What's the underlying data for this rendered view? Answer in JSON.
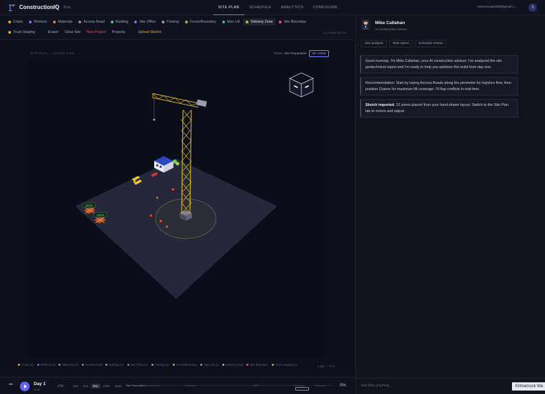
{
  "app": {
    "brand": "ConstructionIQ",
    "badge": "Beta",
    "logo_icon": "crane-logo-icon"
  },
  "nav": {
    "tabs": [
      "SITE PLAN",
      "SCHEDULE",
      "ANALYTICS",
      "CONFIGURE"
    ],
    "active": "SITE PLAN"
  },
  "user": {
    "email": "searchung2008@gmail.c...",
    "avatar_initial": "S"
  },
  "toolbar": {
    "row1": [
      {
        "label": "Crane",
        "color": "#e0a83a"
      },
      {
        "label": "Workers",
        "color": "#4f7fe0"
      },
      {
        "label": "Materials",
        "color": "#e07b3a"
      },
      {
        "label": "Access Road",
        "color": "#8a8f9e"
      },
      {
        "label": "Building",
        "color": "#5fc26b"
      },
      {
        "label": "Site Office",
        "color": "#7d6fe0"
      },
      {
        "label": "Parking",
        "color": "#9a9fae"
      },
      {
        "label": "Fence/Boundary",
        "color": "#c9a13a"
      },
      {
        "label": "Man Lift",
        "color": "#3fb4c9"
      },
      {
        "label": "Delivery Zone",
        "color": "#9fd13a",
        "selected": true
      },
      {
        "label": "Site Boundary",
        "color": "#e05a5a"
      }
    ],
    "row2": [
      {
        "label": "Truck Staging",
        "color": "#d9a23a"
      },
      {
        "label": "Eraser"
      },
      {
        "label": "Clear Site"
      },
      {
        "label": "New Project",
        "style": "red"
      },
      {
        "label": "Projects"
      },
      {
        "label": "Upload Sketch",
        "style": "amber"
      }
    ],
    "zones_placed": "12 zones placed"
  },
  "viewport": {
    "plan_label": "SITE PLAN — 3D/ISO VIEW",
    "phase_label": "Phase:",
    "phase_value": "Site Preparation",
    "view_button": "3D VIEW",
    "badges": [
      "100%",
      "100%"
    ]
  },
  "legend": {
    "items": [
      {
        "label": "Crane (1)",
        "color": "#e0a83a"
      },
      {
        "label": "Workers (4)",
        "color": "#4f7fe0"
      },
      {
        "label": "Materials (2)",
        "color": "#e07b3a"
      },
      {
        "label": "Access Road",
        "color": "#8a8f9e"
      },
      {
        "label": "Building (1)",
        "color": "#5fc26b"
      },
      {
        "label": "Site Office (1)",
        "color": "#7d6fe0"
      },
      {
        "label": "Parking (1)",
        "color": "#9a9fae"
      },
      {
        "label": "Fence/Boundary",
        "color": "#c9a13a"
      },
      {
        "label": "Man Lift (1)",
        "color": "#3fb4c9"
      },
      {
        "label": "Delivery Zone",
        "color": "#9fd13a"
      },
      {
        "label": "Site Boundary",
        "color": "#e05a5a"
      },
      {
        "label": "Truck Staging (1)",
        "color": "#d9a23a"
      }
    ],
    "day_count": "1 day — 12 d"
  },
  "timeline": {
    "skip_icon": "skip-back-icon",
    "day_label": "Day 1",
    "day_of": "of 90",
    "step": "+7d",
    "zooms": [
      "30d",
      "60d",
      "90d",
      "180d",
      "365d"
    ],
    "zoom_selected": "90d",
    "phases": [
      "Site Preparation",
      "Foundation",
      "Structure",
      "MEP",
      "Finishing",
      "Closeout"
    ],
    "progress": "0%"
  },
  "advisor": {
    "name": "Mike Callahan",
    "role": "AI Construction Advisor",
    "tabs": [
      "Site analysis",
      "Risk report",
      "Schedule review"
    ],
    "messages": [
      {
        "text": "Good morning. I'm Mike Callahan, your AI construction advisor. I've analyzed the site geotechnical report and I'm ready to help you optimize this build from day one."
      },
      {
        "text": "Recommendation: Start by laying Access Roads along the perimeter for logistics flow, then position Cranes for maximum lift coverage. I'll flag conflicts in real-time."
      },
      {
        "lead": "Sketch imported.",
        "text": " 12 zones placed from your hand-drawn layout. Switch to the Site Plan tab to review and adjust."
      }
    ],
    "input_placeholder": "Ask Mike anything...",
    "autocomplete": "Kilmarnock Wa"
  }
}
